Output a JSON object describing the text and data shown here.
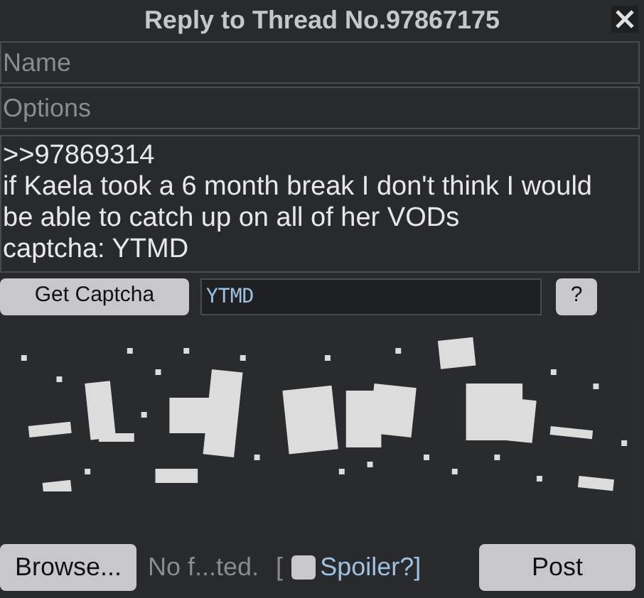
{
  "window": {
    "title": "Reply to Thread No.97867175"
  },
  "fields": [
    {
      "placeholder": "Name"
    },
    {
      "placeholder": "Options"
    }
  ],
  "comment": {
    "value": ">>97869314\nif Kaela took a 6 month break I don't think I would be able to catch up on all of her VODs\ncaptcha: YTMD"
  },
  "captcha": {
    "button": "Get Captcha",
    "value": "YTMD",
    "help": "?"
  },
  "file": {
    "button": "Browse...",
    "status": "No f...ted."
  },
  "spoiler": {
    "open": "[",
    "label": "Spoiler?]",
    "checked": false
  },
  "post": "Post"
}
